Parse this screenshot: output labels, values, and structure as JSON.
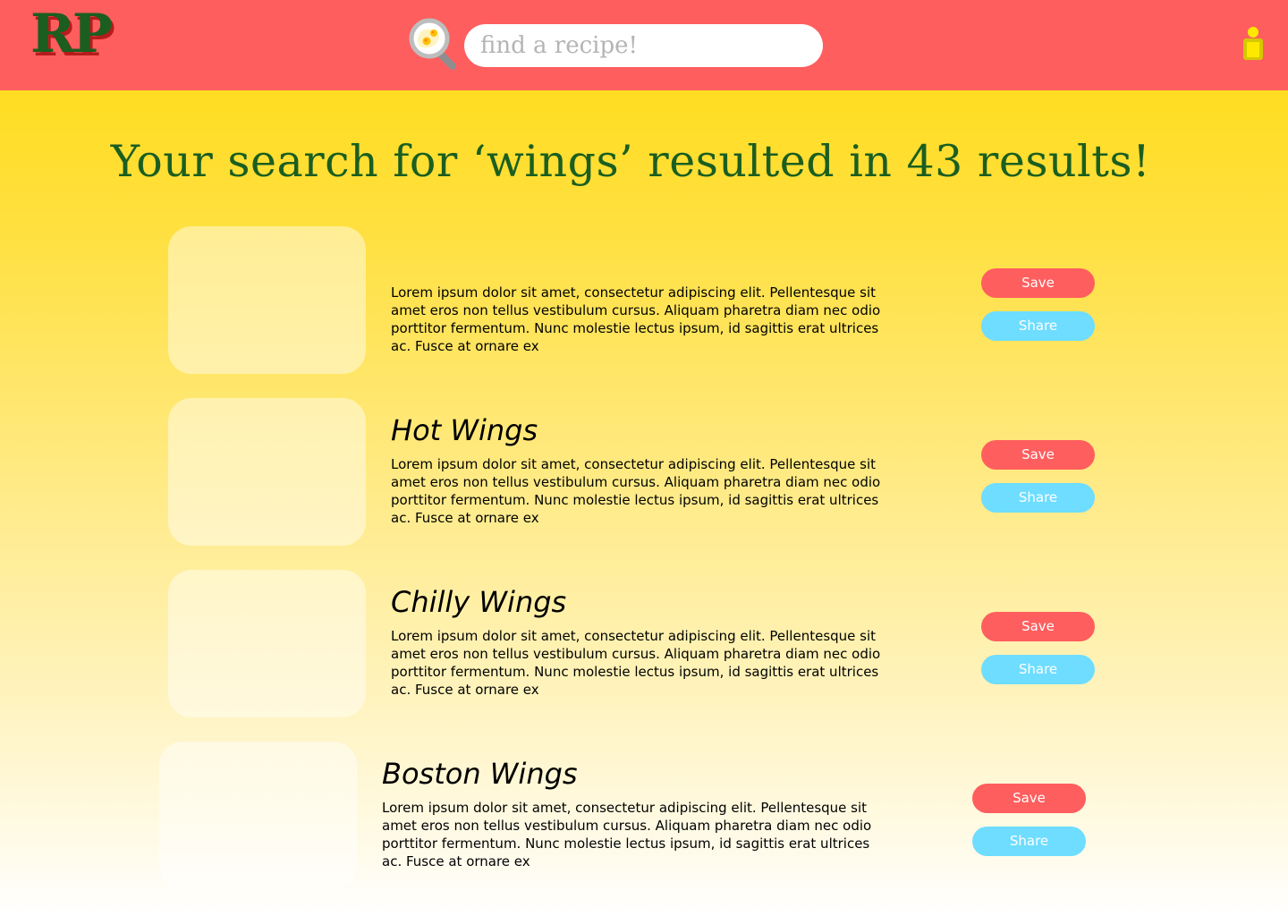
{
  "header": {
    "logo_text": "RP",
    "search": {
      "placeholder": "find a recipe!",
      "value": ""
    },
    "icons": {
      "search": "magnifier-with-eggs-icon",
      "user": "user-profile-icon"
    }
  },
  "main": {
    "title": "Your search for ‘wings’ resulted in 43 results!",
    "results": [
      {
        "title": "",
        "description": "Lorem ipsum dolor sit amet, consectetur adipiscing elit. Pellentesque sit amet eros non tellus vestibulum cursus. Aliquam pharetra diam nec odio porttitor fermentum. Nunc molestie lectus ipsum, id sagittis erat ultrices ac. Fusce at ornare ex",
        "save_label": "Save",
        "share_label": "Share"
      },
      {
        "title": "Hot Wings",
        "description": "Lorem ipsum dolor sit amet, consectetur adipiscing elit. Pellentesque sit amet eros non tellus vestibulum cursus. Aliquam pharetra diam nec odio porttitor fermentum. Nunc molestie lectus ipsum, id sagittis erat ultrices ac. Fusce at ornare ex",
        "save_label": "Save",
        "share_label": "Share"
      },
      {
        "title": "Chilly Wings",
        "description": "Lorem ipsum dolor sit amet, consectetur adipiscing elit. Pellentesque sit amet eros non tellus vestibulum cursus. Aliquam pharetra diam nec odio porttitor fermentum. Nunc molestie lectus ipsum, id sagittis erat ultrices ac. Fusce at ornare ex",
        "save_label": "Save",
        "share_label": "Share"
      },
      {
        "title": "Boston Wings",
        "description": "Lorem ipsum dolor sit amet, consectetur adipiscing elit. Pellentesque sit amet eros non tellus vestibulum cursus. Aliquam pharetra diam nec odio porttitor fermentum. Nunc molestie lectus ipsum, id sagittis erat ultrices ac. Fusce at ornare ex",
        "save_label": "Save",
        "share_label": "Share"
      }
    ]
  },
  "colors": {
    "header_bg": "#FF5E5E",
    "page_bg_top": "#FFDD22",
    "page_bg_bottom": "#FFFFFF",
    "title_text": "#1B5E20",
    "save_button": "#FF5E5E",
    "share_button": "#6EDDFF",
    "user_icon": "#FFE800"
  }
}
